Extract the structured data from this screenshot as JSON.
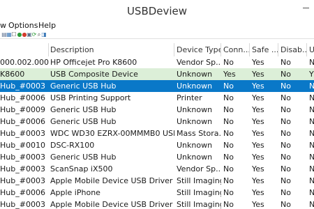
{
  "window": {
    "title": "USBDeview"
  },
  "menu": [
    "w",
    "Options",
    "Help"
  ],
  "toolbar": [
    {
      "icon": "save-icon",
      "glyph": "▤"
    },
    {
      "icon": "html-report-icon",
      "glyph": "▦"
    },
    {
      "icon": "select-icon",
      "glyph": "☐"
    },
    {
      "icon": "enable-icon",
      "glyph": "●"
    },
    {
      "icon": "disable-icon",
      "glyph": "●"
    },
    {
      "icon": "properties-icon",
      "glyph": "▣"
    },
    {
      "icon": "refresh-icon",
      "glyph": "⟳"
    },
    {
      "icon": "search-icon",
      "glyph": "⌕"
    },
    {
      "icon": "about-icon",
      "glyph": "◨"
    }
  ],
  "table": {
    "columns": [
      "",
      "Description",
      "Device Type",
      "Conn...",
      "Safe ...",
      "Disab...",
      "U"
    ],
    "rows": [
      {
        "style": "normal",
        "cells": [
          "000.002.000...",
          "HP Officejet Pro K8600",
          "Vendor Sp...",
          "No",
          "Yes",
          "No",
          "N"
        ]
      },
      {
        "style": "green",
        "cells": [
          "K8600",
          "USB Composite Device",
          "Unknown",
          "Yes",
          "Yes",
          "No",
          "Y"
        ]
      },
      {
        "style": "selected",
        "cells": [
          "Hub_#0003",
          "Generic USB Hub",
          "Unknown",
          "No",
          "Yes",
          "No",
          "N"
        ]
      },
      {
        "style": "normal",
        "cells": [
          "Hub_#0006",
          "USB Printing Support",
          "Printer",
          "No",
          "Yes",
          "No",
          "N"
        ]
      },
      {
        "style": "normal",
        "cells": [
          "Hub_#0009",
          "Generic USB Hub",
          "Unknown",
          "No",
          "Yes",
          "No",
          "N"
        ]
      },
      {
        "style": "normal",
        "cells": [
          "Hub_#0006",
          "Generic USB Hub",
          "Unknown",
          "No",
          "Yes",
          "No",
          "N"
        ]
      },
      {
        "style": "normal",
        "cells": [
          "Hub_#0003",
          "WDC WD30 EZRX-00MMMB0 USB ...",
          "Mass Stora...",
          "No",
          "Yes",
          "No",
          "N"
        ]
      },
      {
        "style": "normal",
        "cells": [
          "Hub_#0010",
          "DSC-RX100",
          "Unknown",
          "No",
          "Yes",
          "No",
          "N"
        ]
      },
      {
        "style": "normal",
        "cells": [
          "Hub_#0003",
          "Generic USB Hub",
          "Unknown",
          "No",
          "Yes",
          "No",
          "N"
        ]
      },
      {
        "style": "normal",
        "cells": [
          "Hub_#0003",
          "ScanSnap iX500",
          "Vendor Sp...",
          "No",
          "Yes",
          "No",
          "N"
        ]
      },
      {
        "style": "normal",
        "cells": [
          "Hub_#0003",
          "Apple Mobile Device USB Driver",
          "Still Imaging",
          "No",
          "Yes",
          "No",
          "N"
        ]
      },
      {
        "style": "normal",
        "cells": [
          "Hub_#0006",
          "Apple iPhone",
          "Still Imaging",
          "No",
          "Yes",
          "No",
          "N"
        ]
      },
      {
        "style": "normal",
        "cells": [
          "Hub_#0003",
          "Apple Mobile Device USB Driver",
          "Still Imaging",
          "No",
          "Yes",
          "No",
          "N"
        ]
      }
    ]
  },
  "colors": {
    "selected_row": "#0a78c8",
    "connected_row": "#dcefd8",
    "toolbar_green": "#2e9d3a",
    "toolbar_red": "#d23b2c"
  }
}
